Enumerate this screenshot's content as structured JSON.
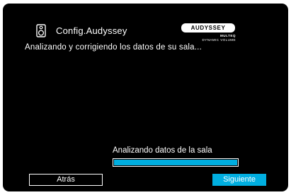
{
  "header": {
    "icon": "speaker-icon",
    "title": "Config.Audyssey"
  },
  "logo": {
    "brand": "AUDYSSEY",
    "line1": "MULTEQ",
    "line2": "DYNAMIC VOLUME"
  },
  "status": {
    "message": "Analizando y corrigiendo los datos de su sala..."
  },
  "progress": {
    "label": "Analizando datos de la sala",
    "value": 1.0,
    "color": "#00aee0"
  },
  "buttons": {
    "back_label": "Atrás",
    "next_label": "Siguiente"
  },
  "colors": {
    "background": "#000000",
    "text": "#ffffff",
    "accent": "#00aee0"
  }
}
